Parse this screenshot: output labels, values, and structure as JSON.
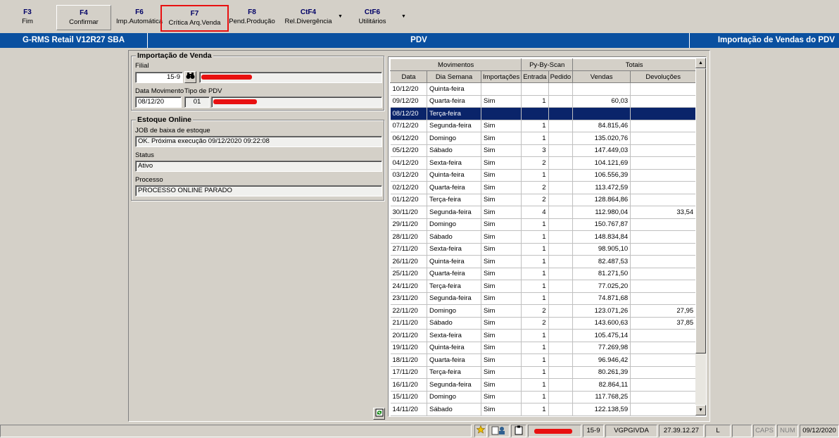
{
  "toolbar": {
    "buttons": [
      {
        "key": "F3",
        "label": "Fim"
      },
      {
        "key": "F4",
        "label": "Confirmar"
      },
      {
        "key": "F6",
        "label": "Imp.Automática"
      },
      {
        "key": "F7",
        "label": "Crítica Arq.Venda"
      },
      {
        "key": "F8",
        "label": "Pend.Produção"
      },
      {
        "key": "CtF4",
        "label": "Rel.Divergência"
      },
      {
        "key": "CtF6",
        "label": "Utilitários"
      }
    ],
    "arrow": "▼"
  },
  "header": {
    "app": "G-RMS Retail V12R27 SBA",
    "module": "PDV",
    "screen": "Importação de Vendas do PDV"
  },
  "venda": {
    "title": "Importação de Venda",
    "filial_label": "Filial",
    "filial_value": "15-9",
    "data_mov_label": "Data Movimento",
    "data_mov_value": "08/12/20",
    "tipo_pdv_label": "Tipo de PDV",
    "tipo_pdv_value": "01"
  },
  "estoque": {
    "title": "Estoque Online",
    "job_label": "JOB de baixa de estoque",
    "job_value": "OK. Próxima execução 09/12/2020 09:22:08",
    "status_label": "Status",
    "status_value": "Ativo",
    "processo_label": "Processo",
    "processo_value": "PROCESSO ONLINE PARADO"
  },
  "grid": {
    "group_headers": [
      "Movimentos",
      "Py-By-Scan",
      "Totais"
    ],
    "columns": [
      "Data",
      "Dia Semana",
      "Importações",
      "Entrada",
      "Pedido",
      "Vendas",
      "Devoluções"
    ],
    "selected_row": 2,
    "rows": [
      [
        "10/12/20",
        "Quinta-feira",
        "",
        "",
        "",
        "",
        ""
      ],
      [
        "09/12/20",
        "Quarta-feira",
        "Sim",
        "1",
        "",
        "60,03",
        ""
      ],
      [
        "08/12/20",
        "Terça-feira",
        "",
        "",
        "",
        "",
        ""
      ],
      [
        "07/12/20",
        "Segunda-feira",
        "Sim",
        "1",
        "",
        "84.815,46",
        ""
      ],
      [
        "06/12/20",
        "Domingo",
        "Sim",
        "1",
        "",
        "135.020,76",
        ""
      ],
      [
        "05/12/20",
        "Sábado",
        "Sim",
        "3",
        "",
        "147.449,03",
        ""
      ],
      [
        "04/12/20",
        "Sexta-feira",
        "Sim",
        "2",
        "",
        "104.121,69",
        ""
      ],
      [
        "03/12/20",
        "Quinta-feira",
        "Sim",
        "1",
        "",
        "106.556,39",
        ""
      ],
      [
        "02/12/20",
        "Quarta-feira",
        "Sim",
        "2",
        "",
        "113.472,59",
        ""
      ],
      [
        "01/12/20",
        "Terça-feira",
        "Sim",
        "2",
        "",
        "128.864,86",
        ""
      ],
      [
        "30/11/20",
        "Segunda-feira",
        "Sim",
        "4",
        "",
        "112.980,04",
        "33,54"
      ],
      [
        "29/11/20",
        "Domingo",
        "Sim",
        "1",
        "",
        "150.767,87",
        ""
      ],
      [
        "28/11/20",
        "Sábado",
        "Sim",
        "1",
        "",
        "148.834,84",
        ""
      ],
      [
        "27/11/20",
        "Sexta-feira",
        "Sim",
        "1",
        "",
        "98.905,10",
        ""
      ],
      [
        "26/11/20",
        "Quinta-feira",
        "Sim",
        "1",
        "",
        "82.487,53",
        ""
      ],
      [
        "25/11/20",
        "Quarta-feira",
        "Sim",
        "1",
        "",
        "81.271,50",
        ""
      ],
      [
        "24/11/20",
        "Terça-feira",
        "Sim",
        "1",
        "",
        "77.025,20",
        ""
      ],
      [
        "23/11/20",
        "Segunda-feira",
        "Sim",
        "1",
        "",
        "74.871,68",
        ""
      ],
      [
        "22/11/20",
        "Domingo",
        "Sim",
        "2",
        "",
        "123.071,26",
        "27,95"
      ],
      [
        "21/11/20",
        "Sábado",
        "Sim",
        "2",
        "",
        "143.600,63",
        "37,85"
      ],
      [
        "20/11/20",
        "Sexta-feira",
        "Sim",
        "1",
        "",
        "105.475,14",
        ""
      ],
      [
        "19/11/20",
        "Quinta-feira",
        "Sim",
        "1",
        "",
        "77.269,98",
        ""
      ],
      [
        "18/11/20",
        "Quarta-feira",
        "Sim",
        "1",
        "",
        "96.946,42",
        ""
      ],
      [
        "17/11/20",
        "Terça-feira",
        "Sim",
        "1",
        "",
        "80.261,39",
        ""
      ],
      [
        "16/11/20",
        "Segunda-feira",
        "Sim",
        "1",
        "",
        "82.864,11",
        ""
      ],
      [
        "15/11/20",
        "Domingo",
        "Sim",
        "1",
        "",
        "117.768,25",
        ""
      ],
      [
        "14/11/20",
        "Sábado",
        "Sim",
        "1",
        "",
        "122.138,59",
        ""
      ]
    ]
  },
  "statusbar": {
    "filial": "15-9",
    "program": "VGPGIVDA",
    "ip": "27.39.12.27",
    "mode": "L",
    "caps": "CAPS",
    "num": "NUM",
    "date": "09/12/2020"
  },
  "colors": {
    "header_blue": "#0a50a0",
    "selection": "#0a246a",
    "redaction": "#e81010"
  }
}
